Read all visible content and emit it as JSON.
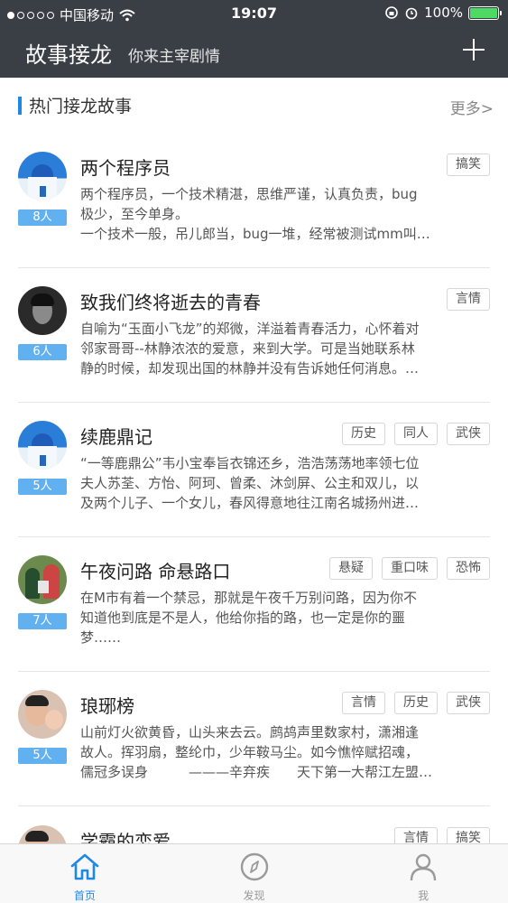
{
  "status": {
    "carrier": "中国移动",
    "time": "19:07",
    "battery": "100%",
    "battery_level": 1.0
  },
  "nav": {
    "title": "故事接龙",
    "subtitle": "你来主宰剧情"
  },
  "section": {
    "title": "热门接龙故事",
    "more": "更多>"
  },
  "stories": [
    {
      "title": "两个程序员",
      "count": "8人",
      "tags": [
        "搞笑"
      ],
      "lines": [
        "两个程序员，一个技术精湛，思维严谨，认真负责，bug",
        "极少，至今单身。",
        "一个技术一般，吊儿郎当，bug一堆，经常被测试mm叫…"
      ]
    },
    {
      "title": "致我们终将逝去的青春",
      "count": "6人",
      "tags": [
        "言情"
      ],
      "lines": [
        "自喻为“玉面小飞龙”的郑微，洋溢着青春活力，心怀着对",
        "邻家哥哥--林静浓浓的爱意，来到大学。可是当她联系林",
        "静的时候，却发现出国的林静并没有告诉她任何消息。…"
      ]
    },
    {
      "title": "续鹿鼎记",
      "count": "5人",
      "tags": [
        "历史",
        "同人",
        "武侠"
      ],
      "lines": [
        "“一等鹿鼎公”韦小宝奉旨衣锦还乡，浩浩荡荡地率领七位",
        "夫人苏荃、方怡、阿珂、曾柔、沐剑屏、公主和双儿，以",
        "及两个儿子、一个女儿，春风得意地往江南名城扬州进…"
      ]
    },
    {
      "title": "午夜问路 命悬路口",
      "count": "7人",
      "tags": [
        "悬疑",
        "重口味",
        "恐怖"
      ],
      "lines": [
        "在M市有着一个禁忌，那就是午夜千万别问路，因为你不",
        "知道他到底是不是人，他给你指的路，也一定是你的噩",
        "梦……"
      ]
    },
    {
      "title": "琅琊榜",
      "count": "5人",
      "tags": [
        "言情",
        "历史",
        "武侠"
      ],
      "lines": [
        "山前灯火欲黄昏，山头来去云。鹧鸪声里数家村，潇湘逢",
        "故人。挥羽扇，整纶巾，少年鞍马尘。如今憔悴赋招魂，",
        "儒冠多误身　　　———辛弃疾　　天下第一大帮江左盟…"
      ]
    }
  ],
  "partial_story": {
    "title": "学霸的恋爱",
    "tags": [
      "言情",
      "搞笑"
    ]
  },
  "tabbar": {
    "items": [
      {
        "label": "首页",
        "icon": "home-icon",
        "active": true
      },
      {
        "label": "发现",
        "icon": "compass-icon",
        "active": false
      },
      {
        "label": "我",
        "icon": "person-icon",
        "active": false
      }
    ],
    "active_color": "#1e88e5",
    "inactive_color": "#999999"
  },
  "colors": {
    "header_bg": "#3a3f46",
    "accent": "#1e88e5",
    "count_badge": "#61b0f0",
    "battery": "#4cd964"
  }
}
